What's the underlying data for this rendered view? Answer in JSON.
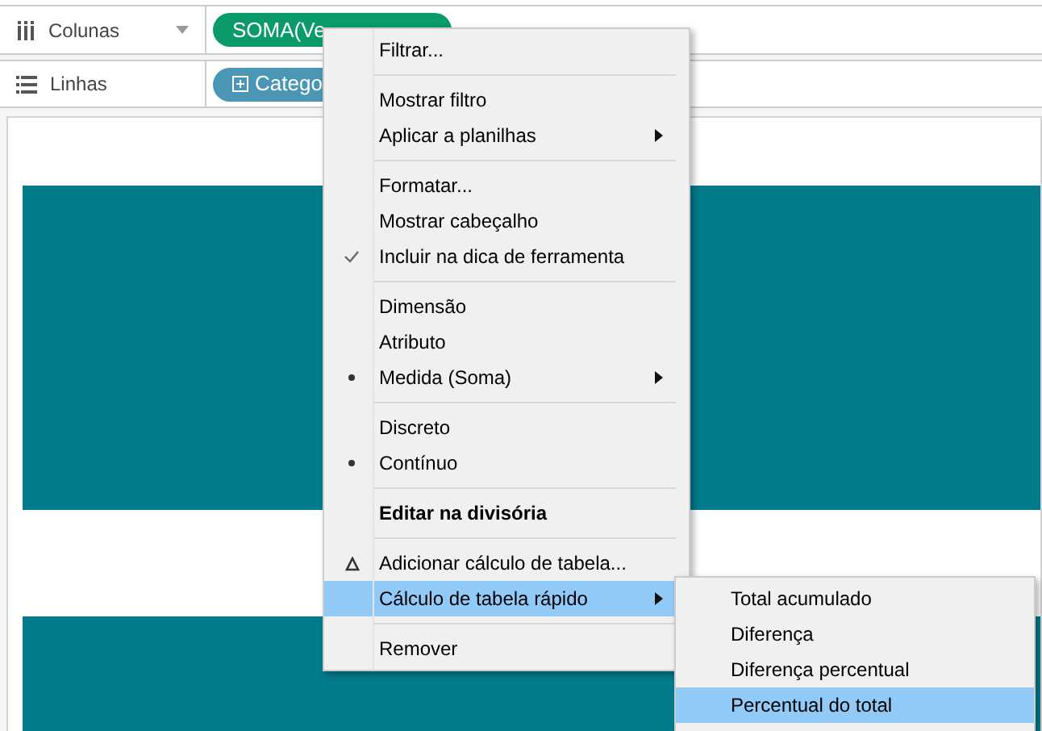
{
  "shelves": [
    {
      "kind": "columns",
      "label": "Colunas",
      "has_dropdown": true,
      "pill": {
        "kind": "measure",
        "text": "SOMA(Ve"
      }
    },
    {
      "kind": "rows",
      "label": "Linhas",
      "has_dropdown": false,
      "pill": {
        "kind": "dimension",
        "text": "Catego"
      }
    }
  ],
  "context_menu": {
    "items": [
      {
        "kind": "command",
        "label": "Filtrar..."
      },
      {
        "kind": "separator"
      },
      {
        "kind": "command",
        "label": "Mostrar filtro"
      },
      {
        "kind": "command",
        "label": "Aplicar a planilhas",
        "submenu": true
      },
      {
        "kind": "separator"
      },
      {
        "kind": "command",
        "label": "Formatar..."
      },
      {
        "kind": "command",
        "label": "Mostrar cabeçalho"
      },
      {
        "kind": "check",
        "label": "Incluir na dica de ferramenta",
        "checked": true
      },
      {
        "kind": "separator"
      },
      {
        "kind": "radio",
        "label": "Dimensão",
        "selected": false
      },
      {
        "kind": "radio",
        "label": "Atributo",
        "selected": false
      },
      {
        "kind": "radio",
        "label": "Medida (Soma)",
        "selected": true,
        "submenu": true
      },
      {
        "kind": "separator"
      },
      {
        "kind": "radio",
        "label": "Discreto",
        "selected": false
      },
      {
        "kind": "radio",
        "label": "Contínuo",
        "selected": true
      },
      {
        "kind": "separator"
      },
      {
        "kind": "command",
        "label": "Editar na divisória",
        "bold": true
      },
      {
        "kind": "separator"
      },
      {
        "kind": "delta",
        "label": "Adicionar cálculo de tabela..."
      },
      {
        "kind": "command",
        "label": "Cálculo de tabela rápido",
        "submenu": true,
        "highlighted": true
      },
      {
        "kind": "separator"
      },
      {
        "kind": "command",
        "label": "Remover"
      }
    ]
  },
  "submenu": {
    "items": [
      {
        "label": "Total acumulado",
        "highlighted": false
      },
      {
        "label": "Diferença",
        "highlighted": false
      },
      {
        "label": "Diferença percentual",
        "highlighted": false
      },
      {
        "label": "Percentual do total",
        "highlighted": true
      }
    ]
  }
}
